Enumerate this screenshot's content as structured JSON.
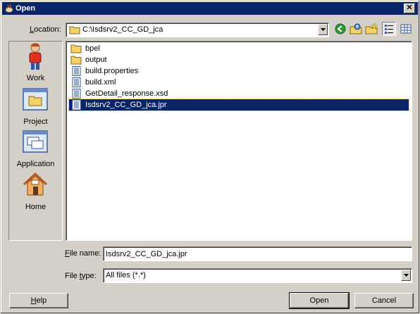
{
  "window": {
    "title": "Open",
    "close_glyph": "✕"
  },
  "location": {
    "label_pre": "",
    "label_key": "L",
    "label_rest": "ocation:",
    "value": "C:\\Isdsrv2_CC_GD_jca"
  },
  "toolbar": {
    "icons": [
      "back-icon",
      "up-folder-icon",
      "new-folder-icon",
      "list-view-icon",
      "details-view-icon"
    ]
  },
  "places": [
    {
      "name": "work",
      "label": "Work",
      "icon": "person-icon"
    },
    {
      "name": "project",
      "label": "Project",
      "icon": "project-window-icon"
    },
    {
      "name": "application",
      "label": "Application",
      "icon": "application-window-icon"
    },
    {
      "name": "home",
      "label": "Home",
      "icon": "house-icon"
    }
  ],
  "files": [
    {
      "name": "bpel",
      "type": "folder"
    },
    {
      "name": "output",
      "type": "folder"
    },
    {
      "name": "build.properties",
      "type": "file"
    },
    {
      "name": "build.xml",
      "type": "file"
    },
    {
      "name": "GetDetail_response.xsd",
      "type": "file"
    },
    {
      "name": "Isdsrv2_CC_GD_jca.jpr",
      "type": "file",
      "selected": true
    }
  ],
  "filename": {
    "label_key": "F",
    "label_rest": "ile name:",
    "value": "Isdsrv2_CC_GD_jca.jpr"
  },
  "filetype": {
    "label_pre": "File ",
    "label_key": "t",
    "label_rest": "ype:",
    "value": "All files (*.*)"
  },
  "buttons": {
    "help_key": "H",
    "help_rest": "elp",
    "open": "Open",
    "cancel": "Cancel"
  },
  "colors": {
    "selection": "#0a246a",
    "titlebar": "#0a246a",
    "face": "#d4d0c8"
  }
}
